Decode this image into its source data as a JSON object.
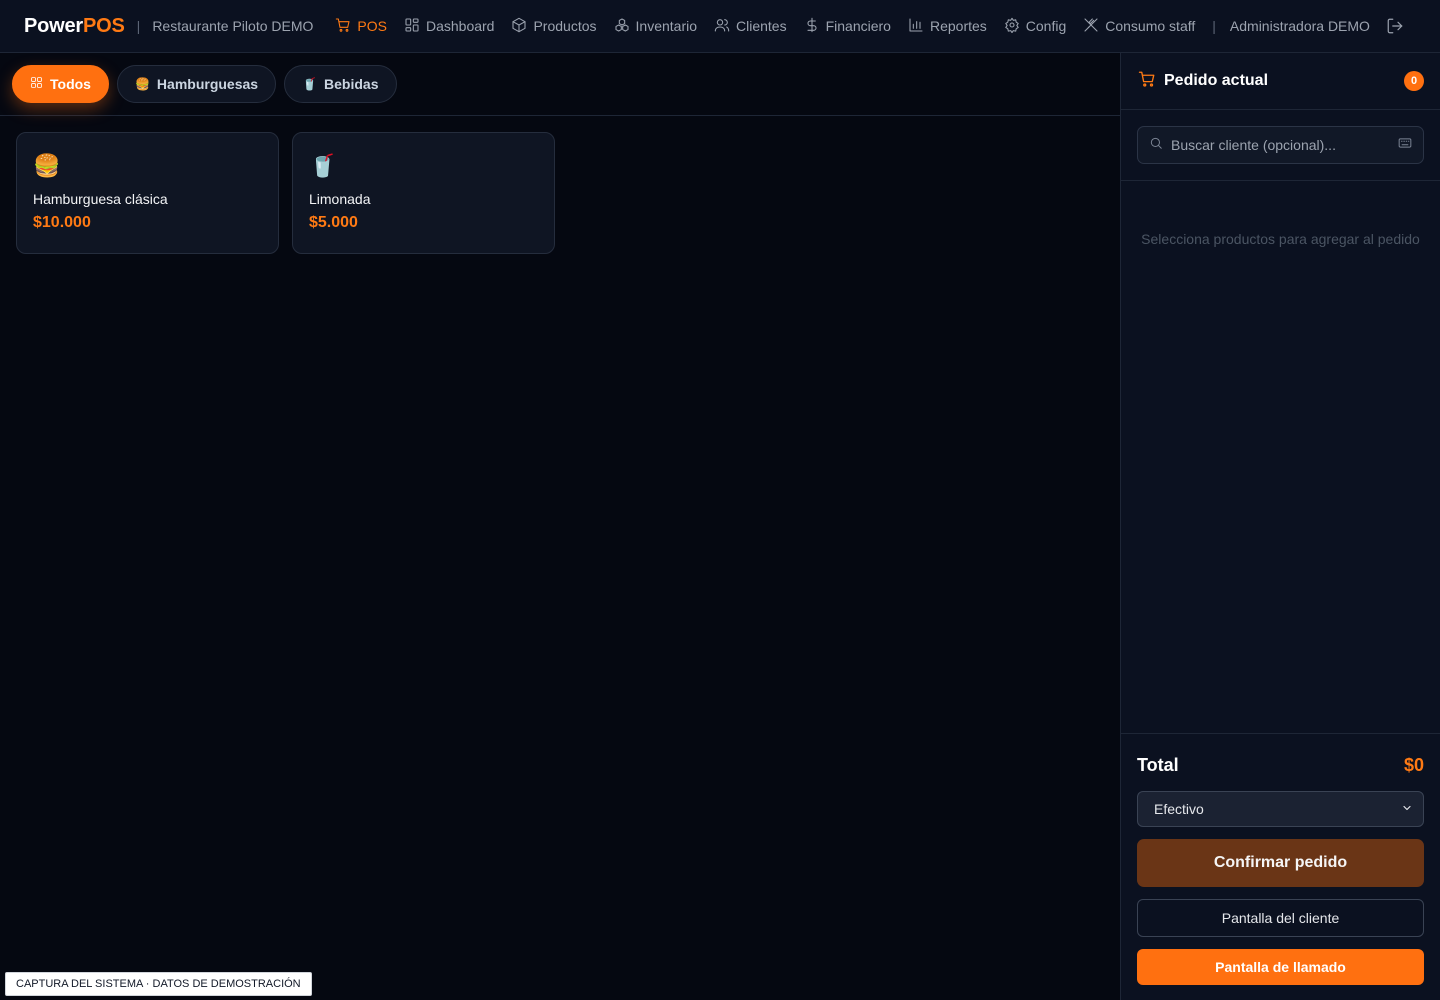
{
  "topbar": {
    "brand_main": "Power",
    "brand_accent": "POS",
    "separator": "|",
    "restaurant": "Restaurante Piloto DEMO",
    "nav": [
      {
        "label": "POS",
        "icon": "cart-icon",
        "active": true
      },
      {
        "label": "Dashboard",
        "icon": "grid-icon"
      },
      {
        "label": "Productos",
        "icon": "box-icon"
      },
      {
        "label": "Inventario",
        "icon": "boxes-icon"
      },
      {
        "label": "Clientes",
        "icon": "users-icon"
      },
      {
        "label": "Financiero",
        "icon": "dollar-icon"
      },
      {
        "label": "Reportes",
        "icon": "bar-chart-icon"
      },
      {
        "label": "Config",
        "icon": "gear-icon"
      },
      {
        "label": "Consumo staff",
        "icon": "utensils-icon"
      }
    ],
    "user": "Administradora DEMO"
  },
  "categories": [
    {
      "label": "Todos",
      "icon": "grid-icon",
      "active": true
    },
    {
      "label": "Hamburguesas",
      "icon": "🍔"
    },
    {
      "label": "Bebidas",
      "icon": "🥤"
    }
  ],
  "products": [
    {
      "emoji": "🍔",
      "name": "Hamburguesa clásica",
      "price": "$10.000"
    },
    {
      "emoji": "🥤",
      "name": "Limonada",
      "price": "$5.000"
    }
  ],
  "order": {
    "title": "Pedido actual",
    "count": "0",
    "search_placeholder": "Buscar cliente (opcional)...",
    "empty_text": "Selecciona productos para agregar al pedido",
    "total_label": "Total",
    "total_value": "$0",
    "payment_method": "Efectivo",
    "confirm_label": "Confirmar pedido",
    "customer_screen_label": "Pantalla del cliente",
    "call_screen_label": "Pantalla de llamado"
  },
  "stamp": "CAPTURA DEL SISTEMA · DATOS DE DEMOSTRACIÓN",
  "colors": {
    "accent": "#ff7010",
    "background": "#050811",
    "panel": "#0b1120",
    "confirm_disabled": "#6a3516"
  }
}
